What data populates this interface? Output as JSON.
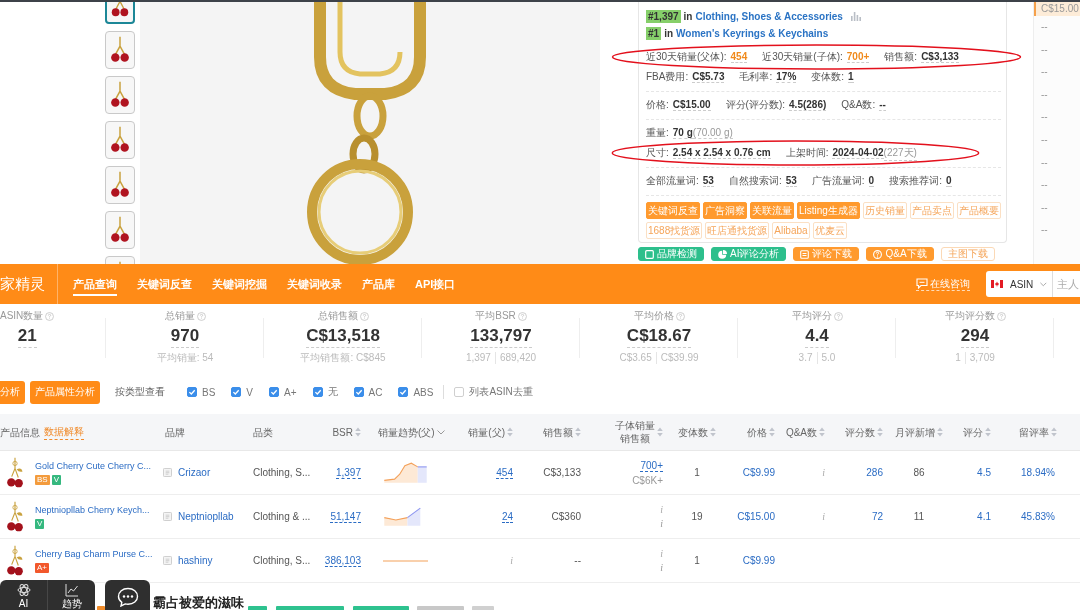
{
  "thumbnails": [
    {
      "selected": true
    },
    {
      "selected": false
    },
    {
      "selected": false
    },
    {
      "selected": false
    },
    {
      "selected": false
    },
    {
      "selected": false
    },
    {
      "selected": false
    }
  ],
  "product_info": {
    "ranks": [
      {
        "rank": "#1,397",
        "joiner": "in",
        "category": "Clothing, Shoes & Accessories",
        "chart_icon": true
      },
      {
        "rank": "#1",
        "joiner": "in",
        "category": "Women's Keyrings & Keychains",
        "chart_icon": false
      }
    ],
    "sections": [
      {
        "lines": [
          {
            "circled": true,
            "fields": [
              {
                "label": "近30天销量(父体):",
                "value": "454",
                "highlight": true
              },
              {
                "label": "近30天销量(子体):",
                "value": "700+",
                "highlight": true
              },
              {
                "label": "销售额:",
                "value": "C$3,133",
                "highlight": false
              }
            ]
          },
          {
            "circled": false,
            "fields": [
              {
                "label": "FBA费用:",
                "value": "C$5.73",
                "highlight": false
              },
              {
                "label": "毛利率:",
                "value": "17%",
                "highlight": false
              },
              {
                "label": "变体数:",
                "value": "1",
                "highlight": false
              }
            ]
          }
        ]
      },
      {
        "lines": [
          {
            "circled": false,
            "fields": [
              {
                "label": "价格:",
                "value": "C$15.00",
                "highlight": false
              },
              {
                "label": "评分(评分数):",
                "value": "4.5(286)",
                "highlight": false
              },
              {
                "label": "Q&A数:",
                "value": "--",
                "highlight": false
              }
            ]
          }
        ]
      },
      {
        "lines": [
          {
            "circled": false,
            "fields": [
              {
                "label": "重量:",
                "value": "70 g",
                "note": "(70.00 g)",
                "highlight": false
              }
            ]
          },
          {
            "circled": true,
            "fields": [
              {
                "label": "尺寸:",
                "value": "2.54 x 2.54 x 0.76 cm",
                "highlight": false
              },
              {
                "label": "上架时间:",
                "value": "2024-04-02",
                "note": "(227天)",
                "highlight": false
              }
            ]
          }
        ]
      },
      {
        "lines": [
          {
            "circled": false,
            "fields": [
              {
                "label": "全部流量词:",
                "value": "53",
                "highlight": false
              },
              {
                "label": "自然搜索词:",
                "value": "53",
                "highlight": false
              },
              {
                "label": "广告流量词:",
                "value": "0",
                "highlight": false
              },
              {
                "label": "搜索推荐词:",
                "value": "0",
                "highlight": false
              }
            ]
          }
        ]
      }
    ],
    "tags": [
      {
        "label": "关键词反查",
        "filled": true
      },
      {
        "label": "广告洞察",
        "filled": true
      },
      {
        "label": "关联流量",
        "filled": true
      },
      {
        "label": "Listing生成器",
        "filled": true
      },
      {
        "label": "历史销量",
        "filled": false
      },
      {
        "label": "产品卖点",
        "filled": false
      },
      {
        "label": "产品概要",
        "filled": false
      },
      {
        "label": "1688找货源",
        "filled": false
      },
      {
        "label": "旺店通找货源",
        "filled": false
      },
      {
        "label": "Alibaba",
        "filled": false
      },
      {
        "label": "优麦云",
        "filled": false
      }
    ]
  },
  "actions": [
    {
      "label": "品牌检测",
      "kind": "green",
      "icon": true
    },
    {
      "label": "AI评论分析",
      "kind": "green",
      "icon": true
    },
    {
      "label": "评论下载",
      "kind": "orange",
      "icon": true
    },
    {
      "label": "Q&A下载",
      "kind": "orange",
      "icon": true
    },
    {
      "label": "主图下载",
      "kind": "outline",
      "icon": false
    }
  ],
  "side_strip": [
    {
      "text": "C$15.00",
      "selected": true
    },
    {
      "text": "--",
      "selected": false
    },
    {
      "text": "--",
      "selected": false
    },
    {
      "text": "--",
      "selected": false
    },
    {
      "text": "--",
      "selected": false
    },
    {
      "text": "--",
      "selected": false
    },
    {
      "text": "--",
      "selected": false
    },
    {
      "text": "--",
      "selected": false
    },
    {
      "text": "--",
      "selected": false
    },
    {
      "text": "--",
      "selected": false
    },
    {
      "text": "--",
      "selected": false
    }
  ],
  "nav": {
    "logo": "家精灵",
    "tabs": [
      {
        "label": "产品查询",
        "selected": true
      },
      {
        "label": "关键词反查",
        "selected": false
      },
      {
        "label": "关键词挖掘",
        "selected": false
      },
      {
        "label": "关键词收录",
        "selected": false
      },
      {
        "label": "产品库",
        "selected": false
      },
      {
        "label": "API接口",
        "selected": false
      }
    ],
    "consult": "在线咨询",
    "market": "ASIN",
    "search_placeholder": "主人"
  },
  "stats": [
    {
      "label": "ASIN数量",
      "value": "21"
    },
    {
      "label": "总销量",
      "value": "970",
      "sub": [
        "平均销量: 54"
      ]
    },
    {
      "label": "总销售额",
      "value": "C$13,518",
      "sub": [
        "平均销售额: C$845"
      ]
    },
    {
      "label": "平均BSR",
      "value": "133,797",
      "sub": [
        "1,397",
        "689,420"
      ]
    },
    {
      "label": "平均价格",
      "value": "C$18.67",
      "sub": [
        "C$3.65",
        "C$39.99"
      ]
    },
    {
      "label": "平均评分",
      "value": "4.4",
      "sub": [
        "3.7",
        "5.0"
      ]
    },
    {
      "label": "平均评分数",
      "value": "294",
      "sub": [
        "1",
        "3,709"
      ]
    }
  ],
  "filters": {
    "buttons": [
      "分析",
      "产品属性分析"
    ],
    "view_label": "按类型查看",
    "types": [
      {
        "label": "BS",
        "checked": true
      },
      {
        "label": "V",
        "checked": true
      },
      {
        "label": "A+",
        "checked": true
      },
      {
        "label": "无",
        "checked": true
      },
      {
        "label": "AC",
        "checked": true
      },
      {
        "label": "ABS",
        "checked": true
      }
    ],
    "dedupe": {
      "label": "列表ASIN去重",
      "checked": false
    }
  },
  "table": {
    "columns": [
      {
        "label": "产品信息",
        "link": "数据解释",
        "kind": "plain"
      },
      {
        "label": "品牌",
        "kind": "plain"
      },
      {
        "label": "品类",
        "kind": "plain"
      },
      {
        "label": "BSR",
        "kind": "sort"
      },
      {
        "label": "销量趋势(父)",
        "kind": "dropdown"
      },
      {
        "label": "销量(父)",
        "kind": "sort"
      },
      {
        "label": "销售额",
        "kind": "sort"
      },
      {
        "label": "子体销量",
        "sublabel": "销售额",
        "kind": "sort"
      },
      {
        "label": "变体数",
        "kind": "sort"
      },
      {
        "label": "价格",
        "kind": "sort"
      },
      {
        "label": "Q&A数",
        "kind": "sort"
      },
      {
        "label": "评分数",
        "kind": "sort"
      },
      {
        "label": "月评新增",
        "kind": "sort"
      },
      {
        "label": "评分",
        "kind": "sort"
      },
      {
        "label": "留评率",
        "kind": "sort"
      }
    ],
    "rows": [
      {
        "cells": [
          {
            "kind": "product",
            "text": "Gold Cherry Cute Cherry C...",
            "badges": [
              {
                "label": "BS",
                "color": "#f39b3d"
              },
              {
                "label": "V",
                "color": "#35b87f"
              }
            ]
          },
          {
            "kind": "brand",
            "text": "Crizaor"
          },
          {
            "kind": "plain",
            "text": "Clothing, S..."
          },
          {
            "kind": "link",
            "text": "1,397"
          },
          {
            "kind": "peak"
          },
          {
            "kind": "link",
            "text": "454"
          },
          {
            "kind": "plain",
            "text": "C$3,133"
          },
          {
            "kind": "link",
            "text": "700+",
            "sub": "C$6K+"
          },
          {
            "kind": "plain",
            "text": "1"
          },
          {
            "kind": "blue",
            "text": "C$9.99"
          },
          {
            "kind": "na",
            "text": "i"
          },
          {
            "kind": "blue",
            "text": "286"
          },
          {
            "kind": "plain",
            "text": "86"
          },
          {
            "kind": "blue",
            "text": "4.5"
          },
          {
            "kind": "blue",
            "text": "18.94%"
          }
        ]
      },
      {
        "cells": [
          {
            "kind": "product",
            "text": "Neptniopllab Cherry Keych...",
            "badges": [
              {
                "label": "V",
                "color": "#35b87f"
              }
            ]
          },
          {
            "kind": "brand",
            "text": "Neptniopllab"
          },
          {
            "kind": "plain",
            "text": "Clothing & ..."
          },
          {
            "kind": "link",
            "text": "51,147"
          },
          {
            "kind": "rise"
          },
          {
            "kind": "link",
            "text": "24"
          },
          {
            "kind": "plain",
            "text": "C$360"
          },
          {
            "kind": "na",
            "text": "i",
            "sub": "i"
          },
          {
            "kind": "plain",
            "text": "19"
          },
          {
            "kind": "blue",
            "text": "C$15.00"
          },
          {
            "kind": "na",
            "text": "i"
          },
          {
            "kind": "blue",
            "text": "72"
          },
          {
            "kind": "plain",
            "text": "11"
          },
          {
            "kind": "blue",
            "text": "4.1"
          },
          {
            "kind": "blue",
            "text": "45.83%"
          }
        ]
      },
      {
        "cells": [
          {
            "kind": "product",
            "text": "Cherry Bag Charm Purse C...",
            "badges": [
              {
                "label": "A+",
                "color": "#f2582c"
              }
            ]
          },
          {
            "kind": "brand",
            "text": "hashiny"
          },
          {
            "kind": "plain",
            "text": "Clothing, S..."
          },
          {
            "kind": "link",
            "text": "386,103"
          },
          {
            "kind": "flat"
          },
          {
            "kind": "na",
            "text": "i"
          },
          {
            "kind": "plain",
            "text": "--"
          },
          {
            "kind": "na",
            "text": "i",
            "sub": "i"
          },
          {
            "kind": "plain",
            "text": "1"
          },
          {
            "kind": "blue",
            "text": "C$9.99"
          }
        ]
      }
    ]
  },
  "overlay": {
    "tools": [
      {
        "label": "AI"
      },
      {
        "label": "趋势"
      }
    ],
    "caption": "霸占被爱的滋味",
    "strips": [
      {
        "color": "#f08c2a"
      },
      {
        "color": "#2ec28f"
      },
      {
        "color": "#2ec28f"
      },
      {
        "color": "#2ec28f"
      },
      {
        "color": "#c8c8c8"
      },
      {
        "color": "#d0d0d0"
      }
    ]
  }
}
